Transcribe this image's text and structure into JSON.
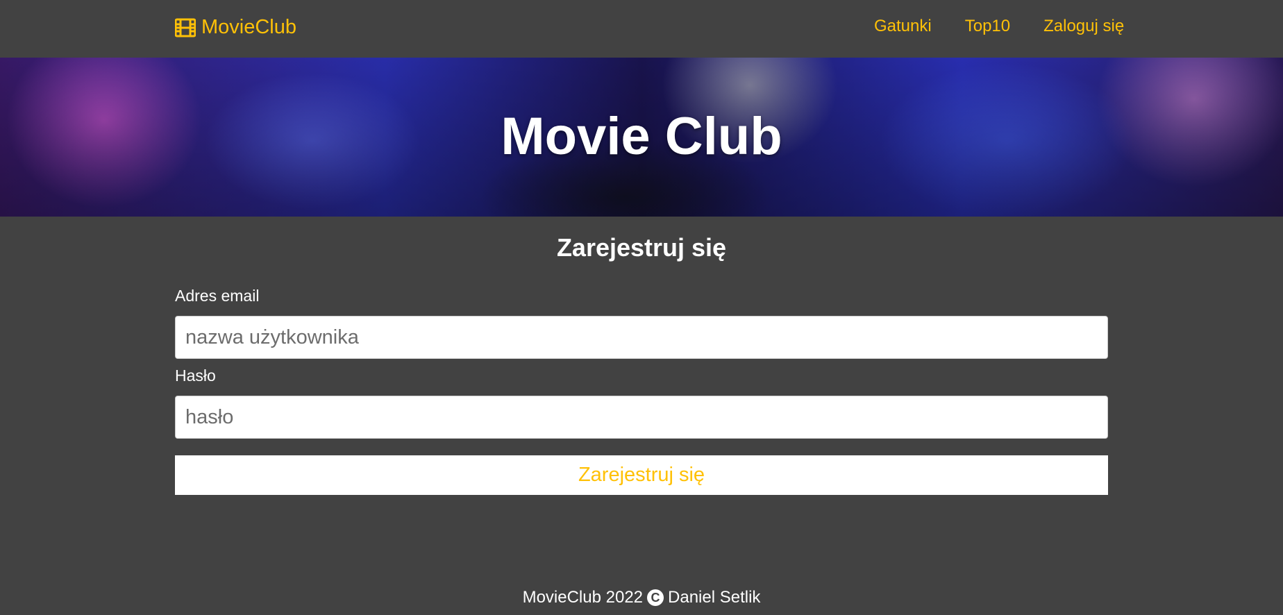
{
  "navbar": {
    "brand_icon": "film-icon",
    "brand": "MovieClub",
    "links": [
      {
        "label": "Gatunki"
      },
      {
        "label": "Top10"
      },
      {
        "label": "Zaloguj się"
      }
    ]
  },
  "hero": {
    "title": "Movie Club"
  },
  "form": {
    "title": "Zarejestruj się",
    "email_label": "Adres email",
    "email_placeholder": "nazwa użytkownika",
    "email_value": "",
    "password_label": "Hasło",
    "password_placeholder": "hasło",
    "password_value": "",
    "submit_label": "Zarejestruj się"
  },
  "footer": {
    "text_before": "MovieClub 2022",
    "copyright_icon": "copyright-icon",
    "copyright_glyph": "C",
    "text_after": "Daniel Setlik"
  },
  "colors": {
    "background": "#424242",
    "accent": "#ffc107",
    "text": "#ffffff"
  }
}
